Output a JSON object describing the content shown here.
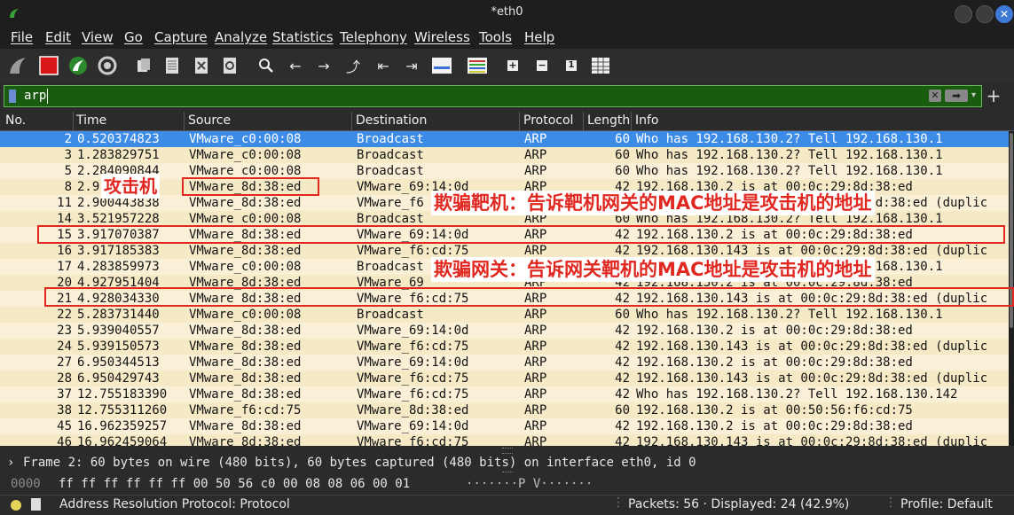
{
  "window": {
    "title": "*eth0"
  },
  "menu": [
    "File",
    "Edit",
    "View",
    "Go",
    "Capture",
    "Analyze",
    "Statistics",
    "Telephony",
    "Wireless",
    "Tools",
    "Help"
  ],
  "toolbar": {
    "icons": [
      "shark-fin-start-icon",
      "stop-capture-icon",
      "restart-capture-icon",
      "capture-options-icon",
      "open-file-icon",
      "save-file-icon",
      "close-file-icon",
      "reload-file-icon",
      "find-packet-icon",
      "go-back-icon",
      "go-forward-icon",
      "go-to-packet-icon",
      "first-packet-icon",
      "last-packet-icon",
      "autoscroll-icon",
      "colorize-icon",
      "zoom-in-icon",
      "zoom-out-icon",
      "normal-size-icon",
      "resize-columns-icon"
    ],
    "glyphs": {
      "find": "🔍",
      "back": "←",
      "forward": "→",
      "goto": "⤴",
      "first": "⇤",
      "last": "⇥",
      "zoom_in": "+",
      "zoom_out": "−",
      "normal": "1"
    }
  },
  "filter": {
    "value": "arp",
    "clear_glyph": "✕",
    "apply_glyph": "➡",
    "drop_glyph": "▾",
    "add_glyph": "+"
  },
  "columns": [
    "No.",
    "Time",
    "Source",
    "Destination",
    "Protocol",
    "Length",
    "Info"
  ],
  "packets": [
    {
      "no": "2",
      "time": "0.520374823",
      "src": "VMware_c0:00:08",
      "dst": "Broadcast",
      "proto": "ARP",
      "len": "60",
      "info": "Who has 192.168.130.2? Tell 192.168.130.1"
    },
    {
      "no": "3",
      "time": "1.283829751",
      "src": "VMware_c0:00:08",
      "dst": "Broadcast",
      "proto": "ARP",
      "len": "60",
      "info": "Who has 192.168.130.2? Tell 192.168.130.1"
    },
    {
      "no": "5",
      "time": "2.284090844",
      "src": "VMware_c0:00:08",
      "dst": "Broadcast",
      "proto": "ARP",
      "len": "60",
      "info": "Who has 192.168.130.2? Tell 192.168.130.1"
    },
    {
      "no": "8",
      "time": "2.9",
      "src": "VMware_8d:38:ed",
      "dst": "VMware_69:14:0d",
      "proto": "ARP",
      "len": "42",
      "info": "192.168.130.2 is at 00:0c:29:8d:38:ed"
    },
    {
      "no": "11",
      "time": "2.900443838",
      "src": "VMware_8d:38:ed",
      "dst": "VMware_f6",
      "proto": "ARP",
      "len": "42",
      "info": "192.168.130.143 is at 00:0c:29:8d:38:ed (duplic"
    },
    {
      "no": "14",
      "time": "3.521957228",
      "src": "VMware_c0:00:08",
      "dst": "Broadcast",
      "proto": "ARP",
      "len": "60",
      "info": "Who has 192.168.130.2? Tell 192.168.130.1"
    },
    {
      "no": "15",
      "time": "3.917070387",
      "src": "VMware_8d:38:ed",
      "dst": "VMware_69:14:0d",
      "proto": "ARP",
      "len": "42",
      "info": "192.168.130.2 is at 00:0c:29:8d:38:ed"
    },
    {
      "no": "16",
      "time": "3.917185383",
      "src": "VMware_8d:38:ed",
      "dst": "VMware_f6:cd:75",
      "proto": "ARP",
      "len": "42",
      "info": "192.168.130.143 is at 00:0c:29:8d:38:ed (duplic"
    },
    {
      "no": "17",
      "time": "4.283859973",
      "src": "VMware_c0:00:08",
      "dst": "Broadcast",
      "proto": "ARP",
      "len": "60",
      "info": "Who has 192.168.130.2? Tell 192.168.130.1"
    },
    {
      "no": "20",
      "time": "4.927951404",
      "src": "VMware_8d:38:ed",
      "dst": "VMware_69",
      "proto": "ARP",
      "len": "42",
      "info": "192.168.130.2 is at 00:0c:29:8d:38:ed"
    },
    {
      "no": "21",
      "time": "4.928034330",
      "src": "VMware_8d:38:ed",
      "dst": "VMware_f6:cd:75",
      "proto": "ARP",
      "len": "42",
      "info": "192.168.130.143 is at 00:0c:29:8d:38:ed (duplic"
    },
    {
      "no": "22",
      "time": "5.283731440",
      "src": "VMware_c0:00:08",
      "dst": "Broadcast",
      "proto": "ARP",
      "len": "60",
      "info": "Who has 192.168.130.2? Tell 192.168.130.1"
    },
    {
      "no": "23",
      "time": "5.939040557",
      "src": "VMware_8d:38:ed",
      "dst": "VMware_69:14:0d",
      "proto": "ARP",
      "len": "42",
      "info": "192.168.130.2 is at 00:0c:29:8d:38:ed"
    },
    {
      "no": "24",
      "time": "5.939150573",
      "src": "VMware_8d:38:ed",
      "dst": "VMware_f6:cd:75",
      "proto": "ARP",
      "len": "42",
      "info": "192.168.130.143 is at 00:0c:29:8d:38:ed (duplic"
    },
    {
      "no": "27",
      "time": "6.950344513",
      "src": "VMware_8d:38:ed",
      "dst": "VMware_69:14:0d",
      "proto": "ARP",
      "len": "42",
      "info": "192.168.130.2 is at 00:0c:29:8d:38:ed"
    },
    {
      "no": "28",
      "time": "6.950429743",
      "src": "VMware_8d:38:ed",
      "dst": "VMware_f6:cd:75",
      "proto": "ARP",
      "len": "42",
      "info": "192.168.130.143 is at 00:0c:29:8d:38:ed (duplic"
    },
    {
      "no": "37",
      "time": "12.755183390",
      "src": "VMware_8d:38:ed",
      "dst": "VMware_f6:cd:75",
      "proto": "ARP",
      "len": "42",
      "info": "Who has 192.168.130.2? Tell 192.168.130.142"
    },
    {
      "no": "38",
      "time": "12.755311260",
      "src": "VMware_f6:cd:75",
      "dst": "VMware_8d:38:ed",
      "proto": "ARP",
      "len": "60",
      "info": "192.168.130.2 is at 00:50:56:f6:cd:75"
    },
    {
      "no": "45",
      "time": "16.962359257",
      "src": "VMware_8d:38:ed",
      "dst": "VMware_69:14:0d",
      "proto": "ARP",
      "len": "42",
      "info": "192.168.130.2 is at 00:0c:29:8d:38:ed"
    },
    {
      "no": "46",
      "time": "16.962459064",
      "src": "VMware_8d:38:ed",
      "dst": "VMware_f6:cd:75",
      "proto": "ARP",
      "len": "42",
      "info": "192.168.130.143 is at 00:0c:29:8d:38:ed (duplic"
    }
  ],
  "annotations": {
    "attacker": "攻击机",
    "spoof_target": "欺骗靶机：告诉靶机网关的MAC地址是攻击机的地址",
    "spoof_gateway": "欺骗网关：告诉网关靶机的MAC地址是攻击机的地址"
  },
  "details": {
    "expander": "›",
    "frame": "Frame 2: 60 bytes on wire (480 bits), 60 bytes captured (480 bits) on interface eth0, id 0"
  },
  "bytes": {
    "offset": "0000",
    "hex": "ff ff ff ff ff ff 00 50  56 c0 00 08 08 06 00 01",
    "ascii": "·······P V·······"
  },
  "status": {
    "protocol": "Address Resolution Protocol: Protocol",
    "packets": "Packets: 56 · Displayed: 24 (42.9%)",
    "profile": "Profile: Default"
  },
  "colors": {
    "selected": "#3c8ce7",
    "row_bg": "#faf0d7",
    "highlight": "#e02820",
    "filter_ok": "#1a5c0f"
  }
}
